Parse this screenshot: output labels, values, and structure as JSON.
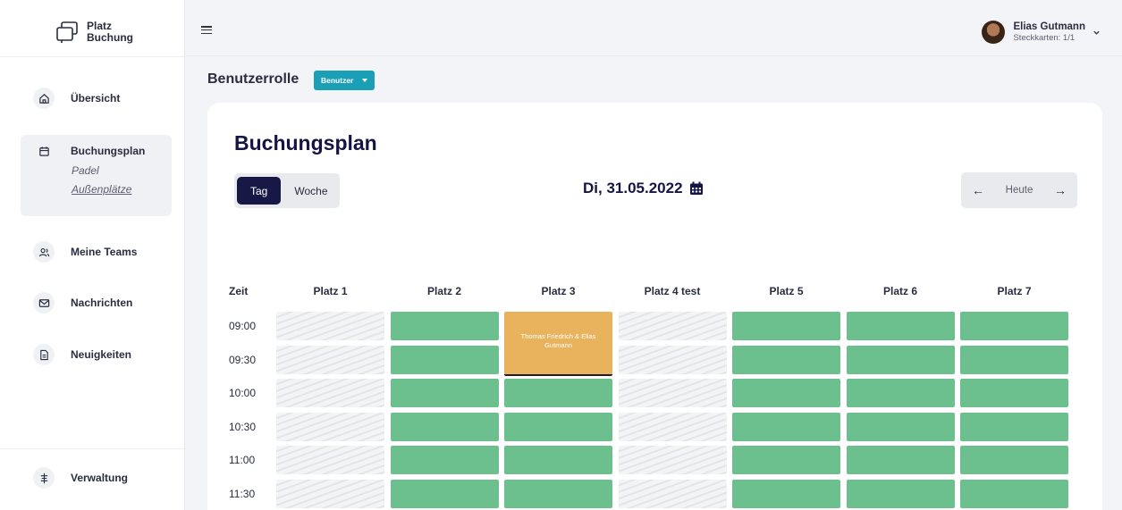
{
  "brand": {
    "line1": "Platz",
    "line2": "Buchung"
  },
  "sidebar": {
    "items": [
      {
        "label": "Übersicht",
        "icon": "home-icon"
      },
      {
        "label": "Buchungsplan",
        "icon": "calendar-icon",
        "subitems": [
          "Padel",
          "Außenplätze"
        ]
      },
      {
        "label": "Meine Teams",
        "icon": "team-icon"
      },
      {
        "label": "Nachrichten",
        "icon": "mail-icon"
      },
      {
        "label": "Neuigkeiten",
        "icon": "document-icon"
      }
    ],
    "bottom": {
      "label": "Verwaltung",
      "icon": "sliders-icon"
    }
  },
  "topbar": {
    "user_name": "Elias Gutmann",
    "user_cards": "Steckkarten: 1/1"
  },
  "role": {
    "title": "Benutzerrolle",
    "selected": "Benutzer"
  },
  "schedule": {
    "title": "Buchungsplan",
    "view_tabs": [
      "Tag",
      "Woche"
    ],
    "active_view": "Tag",
    "date": "Di, 31.05.2022",
    "today_label": "Heute",
    "time_header": "Zeit",
    "courts": [
      "Platz 1",
      "Platz 2",
      "Platz 3",
      "Platz 4 test",
      "Platz 5",
      "Platz 6",
      "Platz 7"
    ],
    "times": [
      "09:00",
      "09:30",
      "10:00",
      "10:30",
      "11:00",
      "11:30"
    ],
    "blocked_courts": [
      "Platz 1",
      "Platz 4 test"
    ],
    "booking": {
      "court": "Platz 3",
      "start": "09:00",
      "end": "10:00",
      "text": "Thomas Friedrich & Elias Gutmann"
    }
  },
  "colors": {
    "free_slot": "#6cc08d",
    "booking": "#e9b35e",
    "accent": "#1a9fb6",
    "primary_dark": "#171846"
  }
}
